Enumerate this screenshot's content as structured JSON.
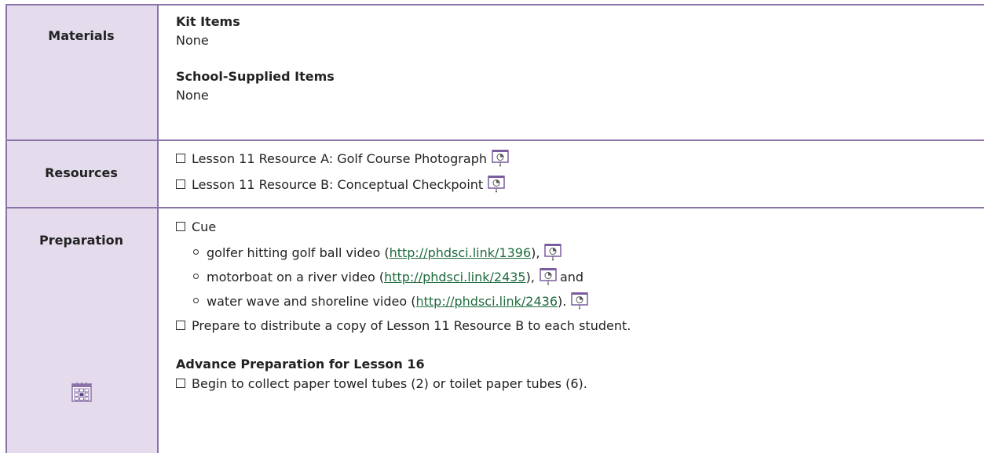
{
  "materials": {
    "label": "Materials",
    "kit_heading": "Kit Items",
    "kit_value": "None",
    "school_heading": "School-Supplied Items",
    "school_value": "None"
  },
  "resources": {
    "label": "Resources",
    "items": [
      "Lesson 11 Resource A: Golf Course Photograph",
      "Lesson 11 Resource B: Conceptual Checkpoint"
    ]
  },
  "preparation": {
    "label": "Preparation",
    "cue": "Cue",
    "videos": [
      {
        "before": "golfer hitting golf ball video (",
        "link": "http://phdsci.link/1396",
        "after": "),",
        "trail": ""
      },
      {
        "before": "motorboat on a river video (",
        "link": "http://phdsci.link/2435",
        "after": "),",
        "trail": "and"
      },
      {
        "before": "water wave and shoreline video (",
        "link": "http://phdsci.link/2436",
        "after": ").",
        "trail": ""
      }
    ],
    "distribute": "Prepare to distribute a copy of Lesson 11 Resource B to each student.",
    "advance_heading": "Advance Preparation for Lesson 16",
    "advance_item": "Begin to collect paper towel tubes (2) or toilet paper tubes (6)."
  },
  "colors": {
    "label_bg": "#e4dcec",
    "border": "#8a72a8",
    "link": "#1e6b3c"
  },
  "icons": {
    "projector": "projector-icon",
    "calendar": "calendar-icon"
  }
}
